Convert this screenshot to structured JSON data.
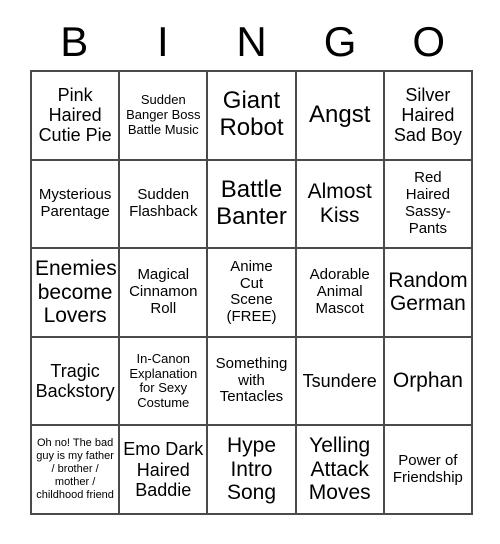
{
  "card": {
    "header_letters": [
      "B",
      "I",
      "N",
      "G",
      "O"
    ],
    "free_space_label": "(FREE)",
    "grid_line_color": "#4a4a4a",
    "background_color": "#ffffff",
    "text_color": "#000000",
    "rows": [
      [
        {
          "text": "Pink\nHaired\nCutie Pie",
          "size": "l"
        },
        {
          "text": "Sudden\nBanger Boss\nBattle Music",
          "size": "s"
        },
        {
          "text": "Giant\nRobot",
          "size": "xxl"
        },
        {
          "text": "Angst",
          "size": "xxl"
        },
        {
          "text": "Silver\nHaired\nSad Boy",
          "size": "l"
        }
      ],
      [
        {
          "text": "Mysterious\nParentage",
          "size": "m"
        },
        {
          "text": "Sudden\nFlashback",
          "size": "m"
        },
        {
          "text": "Battle\nBanter",
          "size": "xxl"
        },
        {
          "text": "Almost\nKiss",
          "size": "xl"
        },
        {
          "text": "Red\nHaired\nSassy-\nPants",
          "size": "m"
        }
      ],
      [
        {
          "text": "Enemies\nbecome\nLovers",
          "size": "xl"
        },
        {
          "text": "Magical\nCinnamon\nRoll",
          "size": "m"
        },
        {
          "text": "Anime\nCut\nScene\n(FREE)",
          "size": "m"
        },
        {
          "text": "Adorable\nAnimal\nMascot",
          "size": "m"
        },
        {
          "text": "Random\nGerman",
          "size": "xl"
        }
      ],
      [
        {
          "text": "Tragic\nBackstory",
          "size": "l"
        },
        {
          "text": "In-Canon\nExplanation\nfor Sexy\nCostume",
          "size": "s"
        },
        {
          "text": "Something\nwith\nTentacles",
          "size": "m"
        },
        {
          "text": "Tsundere",
          "size": "l"
        },
        {
          "text": "Orphan",
          "size": "xl"
        }
      ],
      [
        {
          "text": "Oh no! The bad\nguy is my father\n/ brother /\nmother /\nchildhood friend",
          "size": "xs"
        },
        {
          "text": "Emo Dark\nHaired\nBaddie",
          "size": "l"
        },
        {
          "text": "Hype\nIntro\nSong",
          "size": "xl"
        },
        {
          "text": "Yelling\nAttack\nMoves",
          "size": "xl"
        },
        {
          "text": "Power of\nFriendship",
          "size": "m"
        }
      ]
    ]
  }
}
